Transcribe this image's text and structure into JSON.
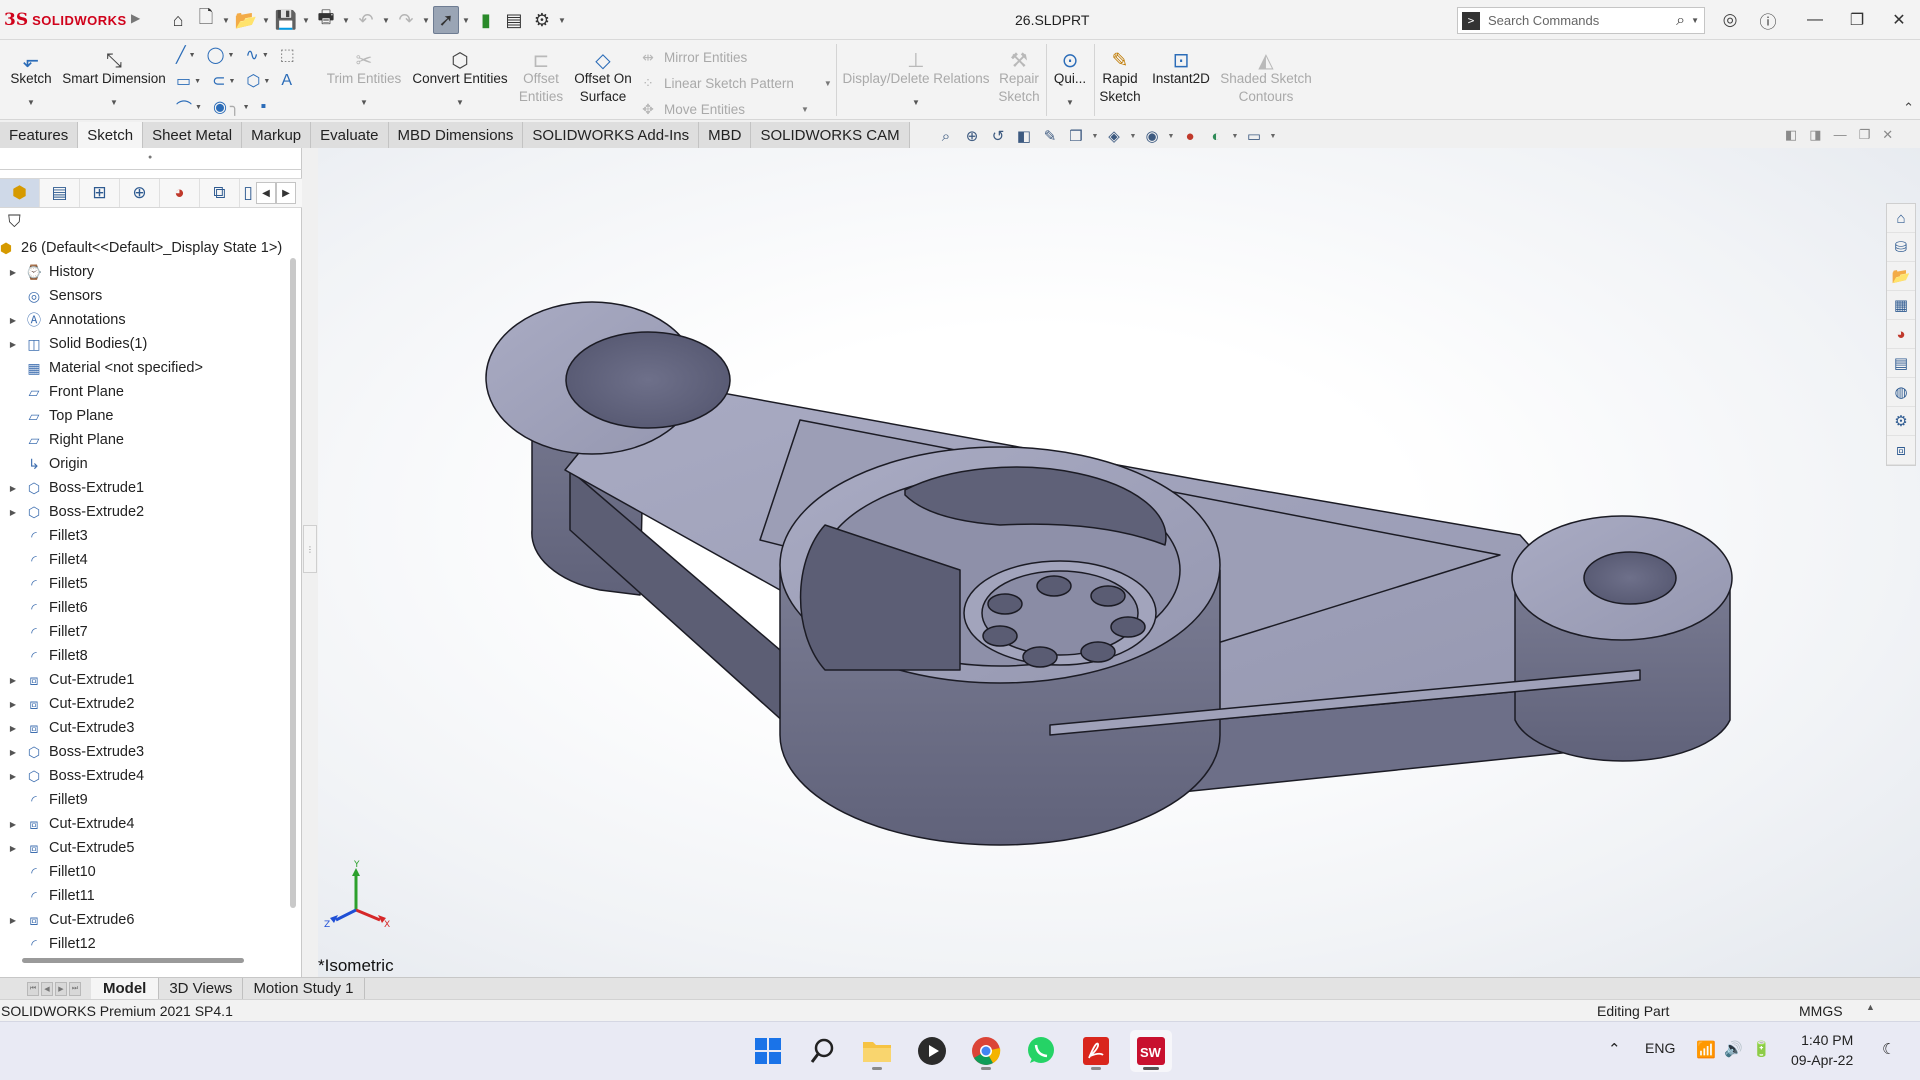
{
  "titlebar": {
    "brand_mark": "3S",
    "brand": "SOLIDWORKS",
    "document_title": "26.SLDPRT",
    "search_placeholder": "Search Commands"
  },
  "ribbon": {
    "buttons": [
      {
        "label": "Sketch",
        "icon": "sketch-icon"
      },
      {
        "label": "Smart Dimension",
        "icon": "smart-dimension-icon"
      },
      {
        "label": "Trim Entities",
        "icon": "trim-icon",
        "disabled": true
      },
      {
        "label": "Convert Entities",
        "icon": "convert-icon"
      },
      {
        "label": "Offset Entities",
        "icon": "offset-icon",
        "disabled": true
      },
      {
        "label": "Offset On Surface",
        "icon": "offset-surface-icon"
      },
      {
        "label": "Display/Delete Relations",
        "icon": "relations-icon",
        "disabled": true
      },
      {
        "label": "Repair Sketch",
        "icon": "repair-icon",
        "disabled": true
      },
      {
        "label": "Qui...",
        "icon": "quick-snaps-icon"
      },
      {
        "label": "Rapid Sketch",
        "icon": "rapid-sketch-icon"
      },
      {
        "label": "Instant2D",
        "icon": "instant2d-icon"
      },
      {
        "label": "Shaded Sketch Contours",
        "icon": "shaded-contours-icon",
        "disabled": true
      }
    ],
    "small": [
      "Mirror Entities",
      "Linear Sketch Pattern",
      "Move Entities"
    ]
  },
  "tabs": [
    "Features",
    "Sketch",
    "Sheet Metal",
    "Markup",
    "Evaluate",
    "MBD Dimensions",
    "SOLIDWORKS Add-Ins",
    "MBD",
    "SOLIDWORKS CAM"
  ],
  "active_tab": "Sketch",
  "tree": {
    "root": "26  (Default<<Default>_Display State 1>)",
    "items": [
      {
        "label": "History",
        "expandable": true,
        "icon": "history-icon"
      },
      {
        "label": "Sensors",
        "expandable": false,
        "icon": "sensors-icon"
      },
      {
        "label": "Annotations",
        "expandable": true,
        "icon": "annotations-icon"
      },
      {
        "label": "Solid Bodies(1)",
        "expandable": true,
        "icon": "solid-bodies-icon"
      },
      {
        "label": "Material <not specified>",
        "expandable": false,
        "icon": "material-icon"
      },
      {
        "label": "Front Plane",
        "expandable": false,
        "icon": "plane-icon"
      },
      {
        "label": "Top Plane",
        "expandable": false,
        "icon": "plane-icon"
      },
      {
        "label": "Right Plane",
        "expandable": false,
        "icon": "plane-icon"
      },
      {
        "label": "Origin",
        "expandable": false,
        "icon": "origin-icon"
      },
      {
        "label": "Boss-Extrude1",
        "expandable": true,
        "icon": "boss-extrude-icon"
      },
      {
        "label": "Boss-Extrude2",
        "expandable": true,
        "icon": "boss-extrude-icon"
      },
      {
        "label": "Fillet3",
        "expandable": false,
        "icon": "fillet-icon"
      },
      {
        "label": "Fillet4",
        "expandable": false,
        "icon": "fillet-icon"
      },
      {
        "label": "Fillet5",
        "expandable": false,
        "icon": "fillet-icon"
      },
      {
        "label": "Fillet6",
        "expandable": false,
        "icon": "fillet-icon"
      },
      {
        "label": "Fillet7",
        "expandable": false,
        "icon": "fillet-icon"
      },
      {
        "label": "Fillet8",
        "expandable": false,
        "icon": "fillet-icon"
      },
      {
        "label": "Cut-Extrude1",
        "expandable": true,
        "icon": "cut-extrude-icon"
      },
      {
        "label": "Cut-Extrude2",
        "expandable": true,
        "icon": "cut-extrude-icon"
      },
      {
        "label": "Cut-Extrude3",
        "expandable": true,
        "icon": "cut-extrude-icon"
      },
      {
        "label": "Boss-Extrude3",
        "expandable": true,
        "icon": "boss-extrude-icon"
      },
      {
        "label": "Boss-Extrude4",
        "expandable": true,
        "icon": "boss-extrude-icon"
      },
      {
        "label": "Fillet9",
        "expandable": false,
        "icon": "fillet-icon"
      },
      {
        "label": "Cut-Extrude4",
        "expandable": true,
        "icon": "cut-extrude-icon"
      },
      {
        "label": "Cut-Extrude5",
        "expandable": true,
        "icon": "cut-extrude-icon"
      },
      {
        "label": "Fillet10",
        "expandable": false,
        "icon": "fillet-icon"
      },
      {
        "label": "Fillet11",
        "expandable": false,
        "icon": "fillet-icon"
      },
      {
        "label": "Cut-Extrude6",
        "expandable": true,
        "icon": "cut-extrude-icon"
      },
      {
        "label": "Fillet12",
        "expandable": false,
        "icon": "fillet-icon"
      }
    ]
  },
  "viewport": {
    "view_label": "*Isometric",
    "triad_labels": {
      "x": "X",
      "y": "Y",
      "z": "Z"
    },
    "model_color": "#9a9cb4"
  },
  "bottom_tabs": [
    "Model",
    "3D Views",
    "Motion Study 1"
  ],
  "active_bottom_tab": "Model",
  "status": {
    "version": "SOLIDWORKS Premium 2021 SP4.1",
    "mode": "Editing Part",
    "units": "MMGS"
  },
  "taskbar": {
    "apps": [
      "windows-start",
      "search",
      "file-explorer",
      "media-player",
      "chrome",
      "whatsapp",
      "acrobat",
      "solidworks"
    ],
    "language": "ENG",
    "time": "1:40 PM",
    "date": "09-Apr-22"
  }
}
